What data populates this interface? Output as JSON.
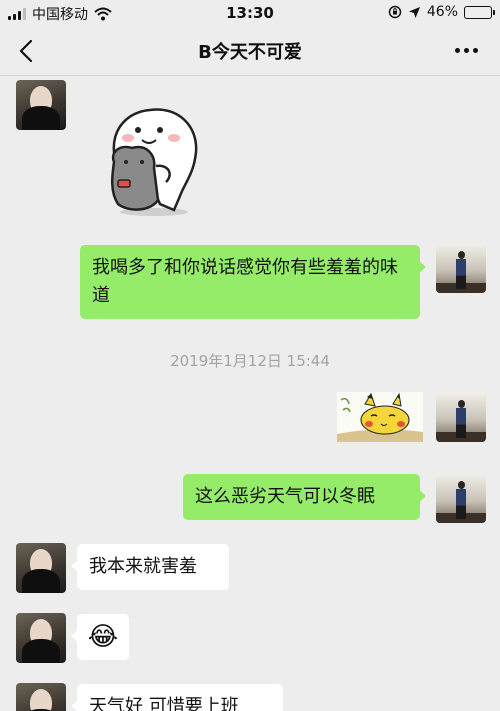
{
  "status_bar": {
    "carrier": "中国移动",
    "time": "13:30",
    "battery_percent": "46%",
    "battery_level": 0.46
  },
  "nav": {
    "title": "B今天不可爱",
    "back_icon": "chevron-left-icon",
    "more_icon": "more-dots-icon"
  },
  "messages": [
    {
      "side": "left",
      "kind": "sticker",
      "sticker": "cartoon-hug-sticker"
    },
    {
      "side": "right",
      "kind": "text",
      "text": "我喝多了和你说话感觉你有些羞羞的味道"
    },
    {
      "kind": "timestamp",
      "text": "2019年1月12日 15:44"
    },
    {
      "side": "right",
      "kind": "sticker",
      "sticker": "pikachu-sticker"
    },
    {
      "side": "right",
      "kind": "text",
      "text": "这么恶劣天气可以冬眠"
    },
    {
      "side": "left",
      "kind": "text",
      "text": "我本来就害羞"
    },
    {
      "side": "left",
      "kind": "emoji",
      "text": "😂"
    },
    {
      "side": "left",
      "kind": "text",
      "text": "天气好 可惜要上班"
    }
  ],
  "colors": {
    "background": "#ededed",
    "self_bubble": "#95ec69",
    "other_bubble": "#ffffff"
  }
}
